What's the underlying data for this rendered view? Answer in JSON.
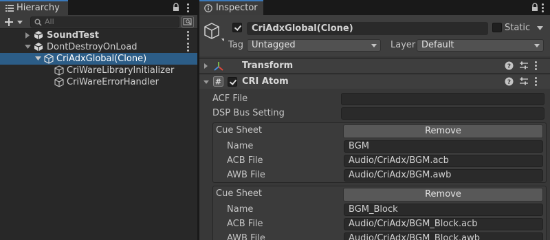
{
  "hierarchy": {
    "tab_label": "Hierarchy",
    "search_placeholder": "All",
    "items": [
      {
        "label": "SoundTest",
        "bold": true
      },
      {
        "label": "DontDestroyOnLoad",
        "bold": false
      },
      {
        "label": "CriAdxGlobal(Clone)",
        "selected": true
      },
      {
        "label": "CriWareLibraryInitializer"
      },
      {
        "label": "CriWareErrorHandler"
      }
    ]
  },
  "inspector": {
    "tab_label": "Inspector",
    "object_name": "CriAdxGlobal(Clone)",
    "static_label": "Static",
    "tag_label": "Tag",
    "tag_value": "Untagged",
    "layer_label": "Layer",
    "layer_value": "Default",
    "components": {
      "transform": {
        "title": "Transform"
      },
      "cri_atom": {
        "title": "CRI Atom",
        "acf_file_label": "ACF File",
        "acf_file_value": "",
        "dsp_bus_label": "DSP Bus Setting",
        "dsp_bus_value": "",
        "cue_sheets": [
          {
            "header_label": "Cue Sheet",
            "remove_label": "Remove",
            "name_label": "Name",
            "name_value": "BGM",
            "acb_label": "ACB File",
            "acb_value": "Audio/CriAdx/BGM.acb",
            "awb_label": "AWB File",
            "awb_value": "Audio/CriAdx/BGM.awb"
          },
          {
            "header_label": "Cue Sheet",
            "remove_label": "Remove",
            "name_label": "Name",
            "name_value": "BGM_Block",
            "acb_label": "ACB File",
            "acb_value": "Audio/CriAdx/BGM_Block.acb",
            "awb_label": "AWB File",
            "awb_value": "Audio/CriAdx/BGM_Block.awb"
          }
        ]
      }
    }
  },
  "colors": {
    "selection": "#2c5d87",
    "tab_accent": "#3a79bb",
    "panel_bg": "#383838",
    "hierarchy_bg": "#282828"
  },
  "icons": [
    "hamburger-icon",
    "lock-icon",
    "kebab-icon",
    "plus-icon",
    "search-icon",
    "unity-scene-icon",
    "gameobject-icon",
    "transform-axes-icon",
    "script-hash-icon",
    "help-icon",
    "presets-icon"
  ]
}
